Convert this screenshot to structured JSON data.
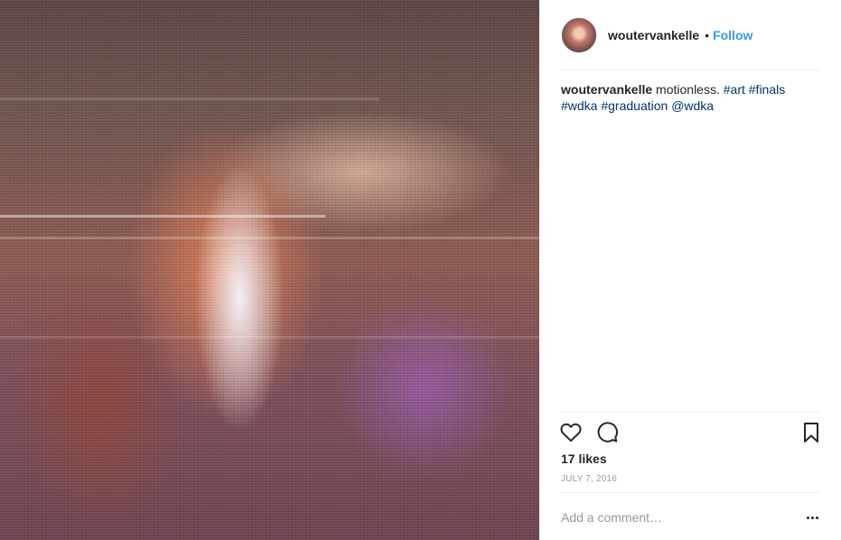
{
  "post": {
    "username": "woutervankelle",
    "separator": "•",
    "follow_label": "Follow",
    "caption": {
      "username": "woutervankelle",
      "text": "motionless.",
      "tags": [
        "#art",
        "#finals",
        "#wdka",
        "#graduation",
        "@wdka"
      ]
    },
    "likes": "17 likes",
    "date": "JULY 7, 2016",
    "comment_placeholder": "Add a comment…"
  },
  "icons": {
    "like": "heart-icon",
    "comment": "comment-bubble-icon",
    "save": "bookmark-icon",
    "more": "more-options-icon"
  },
  "colors": {
    "link": "#3897f0",
    "hashtag": "#003569",
    "muted": "#999999",
    "text": "#262626",
    "divider": "#efefef"
  }
}
